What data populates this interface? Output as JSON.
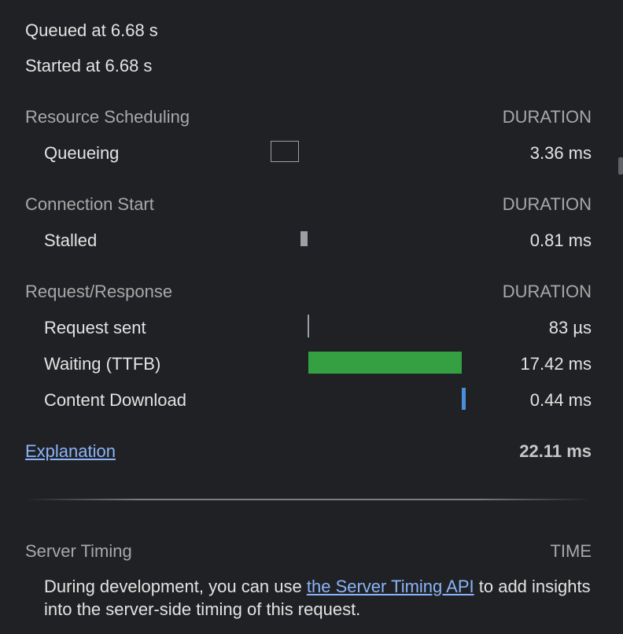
{
  "meta": {
    "queued": "Queued at 6.68 s",
    "started": "Started at 6.68 s"
  },
  "sections": {
    "scheduling": {
      "title": "Resource Scheduling",
      "duration_label": "DURATION",
      "rows": [
        {
          "label": "Queueing",
          "value": "3.36 ms"
        }
      ]
    },
    "connection": {
      "title": "Connection Start",
      "duration_label": "DURATION",
      "rows": [
        {
          "label": "Stalled",
          "value": "0.81 ms"
        }
      ]
    },
    "request_response": {
      "title": "Request/Response",
      "duration_label": "DURATION",
      "rows": [
        {
          "label": "Request sent",
          "value": "83 µs"
        },
        {
          "label": "Waiting (TTFB)",
          "value": "17.42 ms"
        },
        {
          "label": "Content Download",
          "value": "0.44 ms"
        }
      ]
    }
  },
  "footer": {
    "explanation_link": "Explanation",
    "total": "22.11 ms"
  },
  "server_timing": {
    "title": "Server Timing",
    "time_label": "TIME",
    "desc_before": "During development, you can use ",
    "link_text": "the Server Timing API",
    "desc_after": " to add insights into the server-side timing of this request."
  },
  "colors": {
    "background": "#202124",
    "waiting_bar": "#34a041",
    "download_bar": "#4a90d9",
    "stalled_bar": "#9aa0a6",
    "link": "#8ab4f8"
  }
}
